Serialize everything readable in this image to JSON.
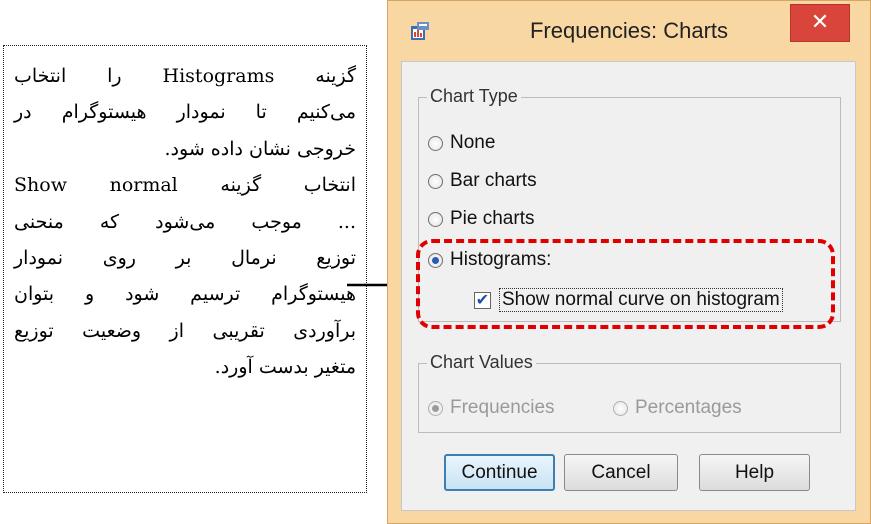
{
  "annotation": {
    "lines": [
      "گزینه Histograms را انتخاب",
      "می‌کنیم تا نمودار هیستوگرام در",
      "خروجی نشان داده شود.",
      "انتخاب گزینه Show normal",
      "... موجب می‌شود که منحنی",
      "توزیع نرمال بر روی نمودار",
      "هیستوگرام ترسیم شود و بتوان",
      "برآوردی تقریبی از وضعیت توزیع",
      "متغیر بدست آورد."
    ]
  },
  "dialog": {
    "title": "Frequencies: Charts",
    "close_label": "✕",
    "chart_type": {
      "legend": "Chart Type",
      "options": [
        "None",
        "Bar charts",
        "Pie charts",
        "Histograms:"
      ],
      "selected": "Histograms:",
      "show_normal_curve_label": "Show normal curve on histogram",
      "show_normal_curve_checked": true
    },
    "chart_values": {
      "legend": "Chart Values",
      "options": [
        "Frequencies",
        "Percentages"
      ],
      "selected": "Frequencies",
      "enabled": false
    },
    "buttons": {
      "continue": "Continue",
      "cancel": "Cancel",
      "help": "Help"
    }
  },
  "colors": {
    "window_frame": "#f9d7a3",
    "highlight": "#e00000",
    "close_button": "#d9453a"
  },
  "icons": {
    "app": "spss-dialog-icon",
    "close": "close-icon",
    "arrow": "arrow-right-icon",
    "check": "checkmark-icon"
  }
}
